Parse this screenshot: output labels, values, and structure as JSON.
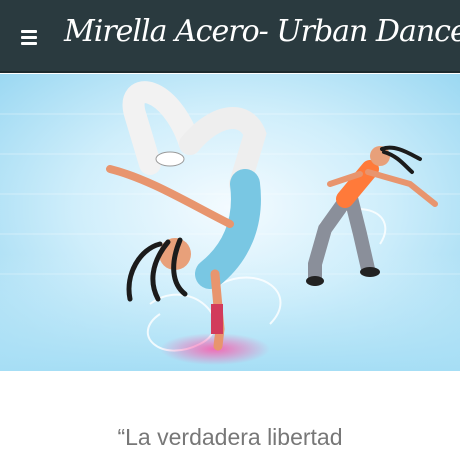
{
  "header": {
    "title": "Mirella Acero- Urban Dance",
    "menu_icon": "hamburger-menu-icon",
    "background": "#2a3a3f"
  },
  "hero": {
    "colors": {
      "sky": "#bfe8f7",
      "accent": "#ff7a3a",
      "glow": "#7fd6ff"
    }
  },
  "quote": {
    "text": "“La verdadera libertad"
  }
}
